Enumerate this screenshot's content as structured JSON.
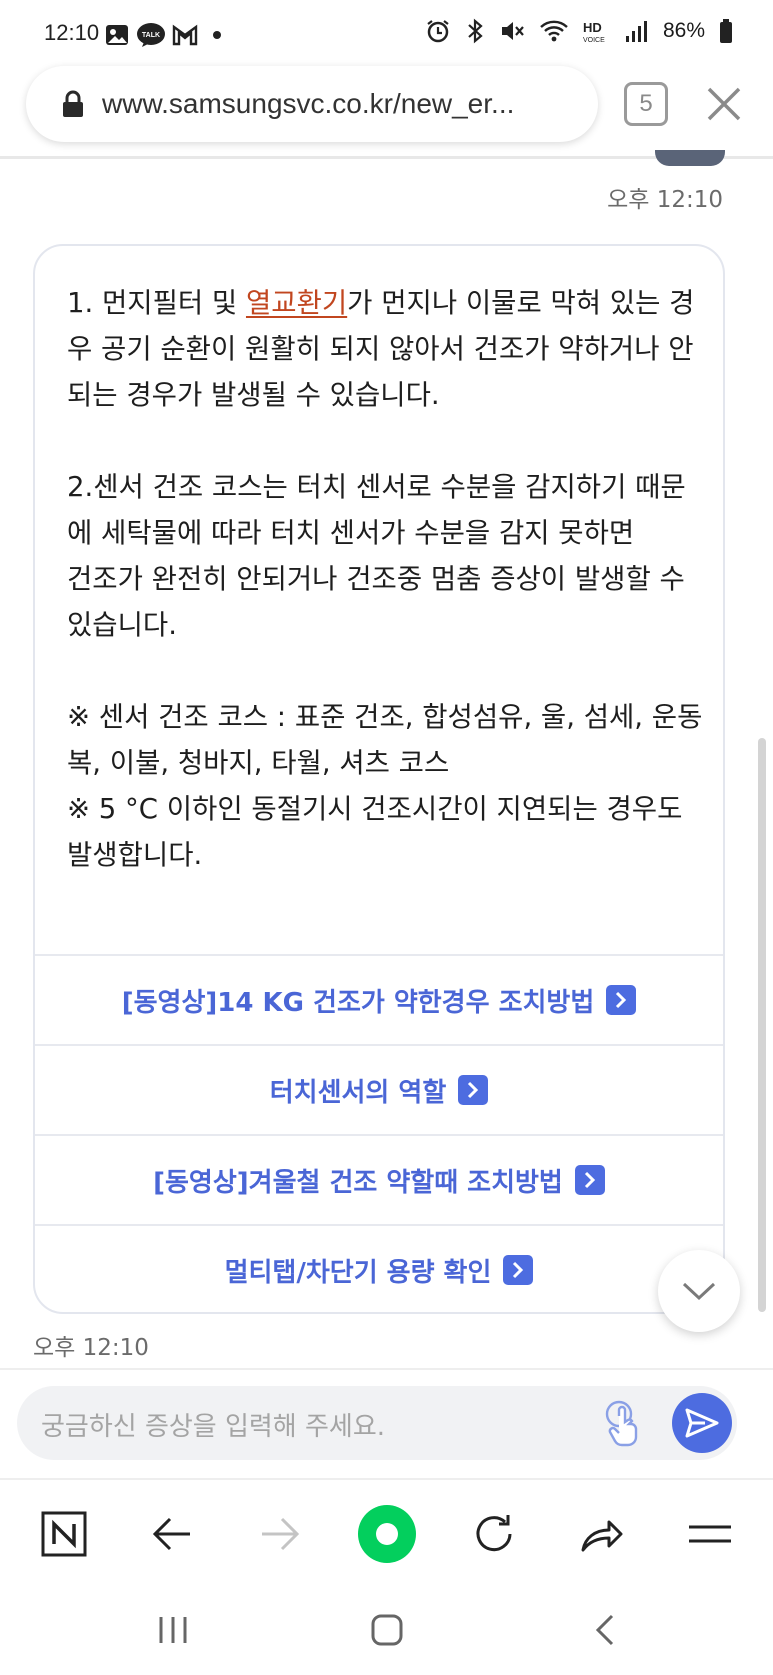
{
  "status_bar": {
    "time": "12:10",
    "battery": "86%",
    "icons": [
      "gallery-icon",
      "talk-icon",
      "gmail-icon",
      "dot-icon",
      "alarm-icon",
      "bluetooth-icon",
      "mute-icon",
      "wifi-icon",
      "hd-voice-icon",
      "signal-icon",
      "battery-icon"
    ]
  },
  "browser": {
    "url": "www.samsungsvc.co.kr/new_er...",
    "tab_count": "5"
  },
  "chat": {
    "timestamp_top": "오후 12:10",
    "timestamp_bottom": "오후 12:10",
    "message": {
      "p1_pre": "1. 먼지필터 및 ",
      "p1_link": "열교환기",
      "p1_post": "가 먼지나 이물로 막혀 있는 경우 공기 순환이 원활히 되지 않아서 건조가 약하거나 안되는 경우가 발생될 수 있습니다.",
      "p2": "2.센서 건조 코스는 터치 센서로 수분을 감지하기 때문에 세탁물에 따라 터치 센서가 수분을 감지 못하면\n건조가 완전히 안되거나 건조중 멈춤 증상이 발생할 수 있습니다.",
      "p3": "※ 센서 건조 코스 : 표준 건조, 합성섬유, 울, 섬세, 운동복, 이불, 청바지, 타월, 셔츠 코스\n※ 5 °C 이하인 동절기시 건조시간이 지연되는 경우도 발생합니다."
    },
    "quick_links": [
      "[동영상]14 KG 건조가 약한경우 조치방법",
      "터치센서의 역할",
      "[동영상]겨울철 건조 약할때 조치방법",
      "멀티탭/차단기 용량 확인"
    ],
    "input_placeholder": "궁금하신 증상을 입력해 주세요."
  },
  "colors": {
    "accent": "#4d6ce0",
    "link_text": "#4a66d6",
    "inline_link": "#c1461f",
    "naver_green": "#03cf5d"
  }
}
